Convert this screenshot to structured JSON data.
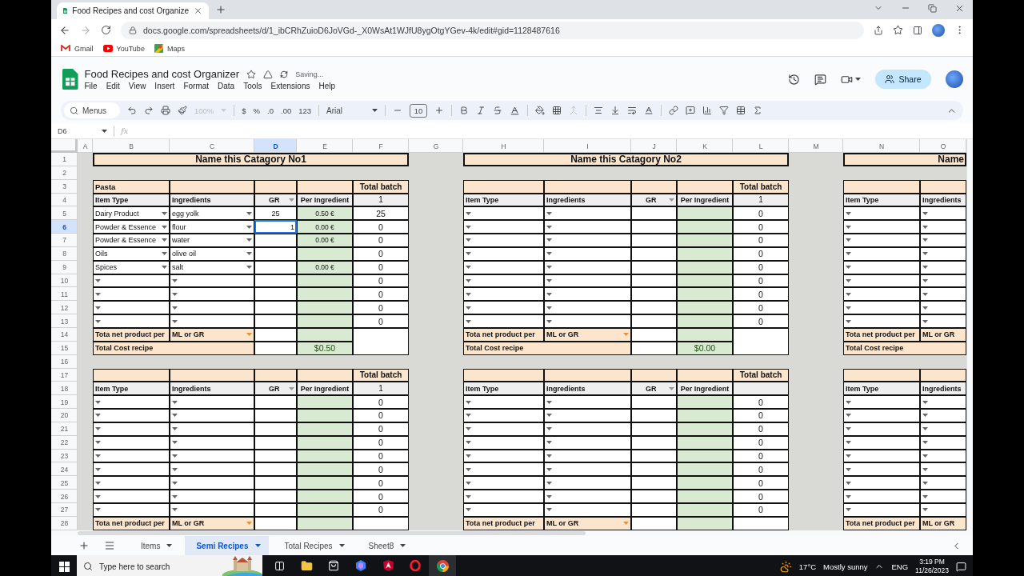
{
  "browser": {
    "tab_title": "Food Recipes and cost Organize",
    "url": "docs.google.com/spreadsheets/d/1_ibCRhZuioD6JoVGd-_X0WsAt1WJfU8ygOtgYGev-4k/edit#gid=1128487616",
    "bookmarks": [
      "Gmail",
      "YouTube",
      "Maps"
    ]
  },
  "doc": {
    "title": "Food Recipes and cost Organizer",
    "status": "Saving...",
    "menu": [
      "File",
      "Edit",
      "View",
      "Insert",
      "Format",
      "Data",
      "Tools",
      "Extensions",
      "Help"
    ],
    "share": "Share"
  },
  "toolbar": {
    "search": "Menus",
    "zoom": "100%",
    "currency": "$",
    "percent": "%",
    "decrease_decimals": ".0",
    "increase_decimals": ".00",
    "number_format": "123",
    "font": "Arial",
    "font_size": "10"
  },
  "formula_bar": {
    "name_box": "D6",
    "function_symbol": "fx"
  },
  "columns": [
    {
      "label": "A",
      "selected": false
    },
    {
      "label": "B",
      "selected": false
    },
    {
      "label": "C",
      "selected": false
    },
    {
      "label": "D",
      "selected": true
    },
    {
      "label": "E",
      "selected": false
    },
    {
      "label": "F",
      "selected": false
    },
    {
      "label": "G",
      "selected": false
    },
    {
      "label": "H",
      "selected": false
    },
    {
      "label": "I",
      "selected": false
    },
    {
      "label": "J",
      "selected": false
    },
    {
      "label": "K",
      "selected": false
    },
    {
      "label": "L",
      "selected": false
    },
    {
      "label": "M",
      "selected": false
    },
    {
      "label": "N",
      "selected": false
    },
    {
      "label": "O",
      "selected": false
    }
  ],
  "rows": [
    {
      "label": "1",
      "selected": false
    },
    {
      "label": "2",
      "selected": false
    },
    {
      "label": "3",
      "selected": false
    },
    {
      "label": "4",
      "selected": false
    },
    {
      "label": "5",
      "selected": false
    },
    {
      "label": "6",
      "selected": true
    },
    {
      "label": "7",
      "selected": false
    },
    {
      "label": "8",
      "selected": false
    },
    {
      "label": "9",
      "selected": false
    },
    {
      "label": "10",
      "selected": false
    },
    {
      "label": "11",
      "selected": false
    },
    {
      "label": "12",
      "selected": false
    },
    {
      "label": "13",
      "selected": false
    },
    {
      "label": "14",
      "selected": false
    },
    {
      "label": "15",
      "selected": false
    },
    {
      "label": "16",
      "selected": false
    },
    {
      "label": "17",
      "selected": false
    },
    {
      "label": "18",
      "selected": false
    },
    {
      "label": "19",
      "selected": false
    },
    {
      "label": "20",
      "selected": false
    },
    {
      "label": "21",
      "selected": false
    },
    {
      "label": "22",
      "selected": false
    },
    {
      "label": "23",
      "selected": false
    },
    {
      "label": "24",
      "selected": false
    },
    {
      "label": "25",
      "selected": false
    },
    {
      "label": "26",
      "selected": false
    },
    {
      "label": "27",
      "selected": false
    },
    {
      "label": "28",
      "selected": false
    }
  ],
  "sections": [
    {
      "blocks": [
        {
          "title": "Name this Catagory No1",
          "name": "Pasta",
          "headers": [
            "Item Type",
            "Ingredients",
            "GR",
            "Per Ingredient"
          ],
          "batch_heading": "Total batch",
          "batch_total": "1",
          "rows": [
            {
              "item_type": "Dairy Product",
              "ingredient": "egg yolk",
              "gr": "25",
              "per_ingredient": "0.50 €",
              "batch": "25",
              "dropdown": true,
              "editing": false
            },
            {
              "item_type": "Powder & Essence",
              "ingredient": "flour",
              "gr": "1",
              "per_ingredient": "0.00 €",
              "batch": "0",
              "dropdown": true,
              "editing": true
            },
            {
              "item_type": "Powder & Essence",
              "ingredient": "water",
              "per_ingredient": "0.00 €",
              "batch": "0",
              "dropdown": true,
              "editing": false
            },
            {
              "item_type": "Oils",
              "ingredient": "olive oil",
              "batch": "0",
              "dropdown": true,
              "editing": false
            },
            {
              "item_type": "Spices",
              "ingredient": "salt",
              "per_ingredient": "0.00 €",
              "batch": "0",
              "dropdown": true,
              "editing": false
            },
            {
              "batch": "0",
              "dropdown": true,
              "editing": false
            },
            {
              "batch": "0",
              "dropdown": true,
              "editing": false
            },
            {
              "batch": "0",
              "dropdown": true,
              "editing": false
            },
            {
              "batch": "0",
              "dropdown": true,
              "editing": false
            }
          ],
          "net_label": "Tota net product per",
          "unit": "ML or GR",
          "cost_label": "Total Cost recipe",
          "cost": "$0.50"
        },
        {
          "title": "Name this Catagory No2",
          "headers": [
            "Item Type",
            "Ingredients",
            "GR",
            "Per Ingredient"
          ],
          "batch_heading": "Total batch",
          "batch_total": "1",
          "rows": [
            {
              "batch": "0",
              "dropdown": true
            },
            {
              "batch": "0",
              "dropdown": true
            },
            {
              "batch": "0",
              "dropdown": true
            },
            {
              "batch": "0",
              "dropdown": true
            },
            {
              "batch": "0",
              "dropdown": true
            },
            {
              "batch": "0",
              "dropdown": true
            },
            {
              "batch": "0",
              "dropdown": true
            },
            {
              "batch": "0",
              "dropdown": true
            },
            {
              "batch": "0",
              "dropdown": true
            }
          ],
          "net_label": "Tota net product per",
          "unit": "ML or GR",
          "cost_label": "Total Cost recipe",
          "cost": "$0.00"
        },
        {
          "title": "Name",
          "headers": [
            "Item Type",
            "Ingredients"
          ],
          "rows": [
            {
              "dropdown": true
            },
            {
              "dropdown": true
            },
            {
              "dropdown": true
            },
            {
              "dropdown": true
            },
            {
              "dropdown": true
            },
            {
              "dropdown": true
            },
            {
              "dropdown": true
            },
            {
              "dropdown": true
            },
            {
              "dropdown": true
            }
          ],
          "net_label": "Tota net product per",
          "unit": "ML or GR",
          "cost_label": "Total Cost recipe"
        }
      ]
    },
    {
      "blocks": [
        {
          "headers": [
            "Item Type",
            "Ingredients",
            "GR",
            "Per Ingredient"
          ],
          "batch_heading": "Total batch",
          "batch_total": "1",
          "rows": [
            {
              "batch": "0",
              "dropdown": true
            },
            {
              "batch": "0",
              "dropdown": true
            },
            {
              "batch": "0",
              "dropdown": true
            },
            {
              "batch": "0",
              "dropdown": true
            },
            {
              "batch": "0",
              "dropdown": true
            },
            {
              "batch": "0",
              "dropdown": true
            },
            {
              "batch": "0",
              "dropdown": true
            },
            {
              "batch": "0",
              "dropdown": true
            },
            {
              "batch": "0",
              "dropdown": true
            }
          ],
          "net_label": "Tota net product per",
          "unit": "ML or GR"
        },
        {
          "headers": [
            "Item Type",
            "Ingredients",
            "GR",
            "Per Ingredient"
          ],
          "batch_heading": "Total batch",
          "rows": [
            {
              "batch": "0",
              "dropdown": true
            },
            {
              "batch": "0",
              "dropdown": true
            },
            {
              "batch": "0",
              "dropdown": true
            },
            {
              "batch": "0",
              "dropdown": true
            },
            {
              "batch": "0",
              "dropdown": true
            },
            {
              "batch": "0",
              "dropdown": true
            },
            {
              "batch": "0",
              "dropdown": true
            },
            {
              "batch": "0",
              "dropdown": true
            },
            {
              "batch": "0",
              "dropdown": true
            }
          ],
          "net_label": "Tota net product per",
          "unit": "ML or GR"
        },
        {
          "headers": [
            "Item Type",
            "Ingredients"
          ],
          "rows": [
            {
              "dropdown": true
            },
            {
              "dropdown": true
            },
            {
              "dropdown": true
            },
            {
              "dropdown": true
            },
            {
              "dropdown": true
            },
            {
              "dropdown": true
            },
            {
              "dropdown": true
            },
            {
              "dropdown": true
            },
            {
              "dropdown": true
            }
          ],
          "net_label": "Tota net product per",
          "unit": "ML or GR"
        }
      ]
    }
  ],
  "sheet_tabs": [
    {
      "label": "Items",
      "selected": false
    },
    {
      "label": "Semi Recipes",
      "selected": true
    },
    {
      "label": "Total Recipes",
      "selected": false
    },
    {
      "label": "Sheet8",
      "selected": false
    }
  ],
  "taskbar": {
    "search_placeholder": "Type here to search",
    "temperature": "17°C",
    "conditions": "Mostly sunny",
    "language": "ENG",
    "time": "3:19 PM",
    "date": "11/26/2023"
  }
}
